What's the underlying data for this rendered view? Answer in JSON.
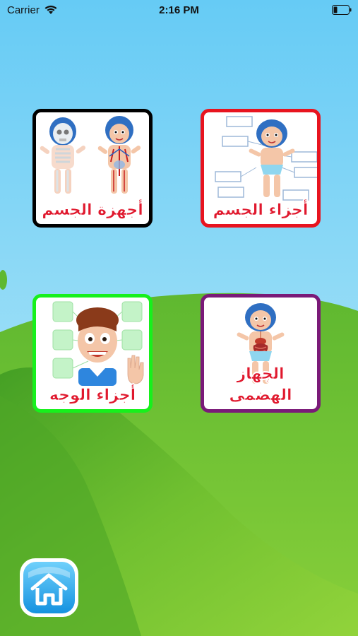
{
  "status_bar": {
    "carrier": "Carrier",
    "time": "2:16 PM"
  },
  "cards": [
    {
      "label": "أجهزة الجسم",
      "border_color": "#000000"
    },
    {
      "label": "أجزاء الجسم",
      "border_color": "#e8141f"
    },
    {
      "label": "أجزاء الوجه",
      "border_color": "#17f01c"
    },
    {
      "label": "الجهاز الهضمى",
      "border_color": "#7a1a78"
    }
  ],
  "home_button": {
    "icon": "house-icon"
  },
  "colors": {
    "sky_top": "#69ccf5",
    "sky_bottom": "#b9ecf8",
    "hill_dark": "#3f9a23",
    "hill_light": "#8ed33a",
    "label_red": "#e0182d",
    "home_blue": "#1aa3ea"
  }
}
